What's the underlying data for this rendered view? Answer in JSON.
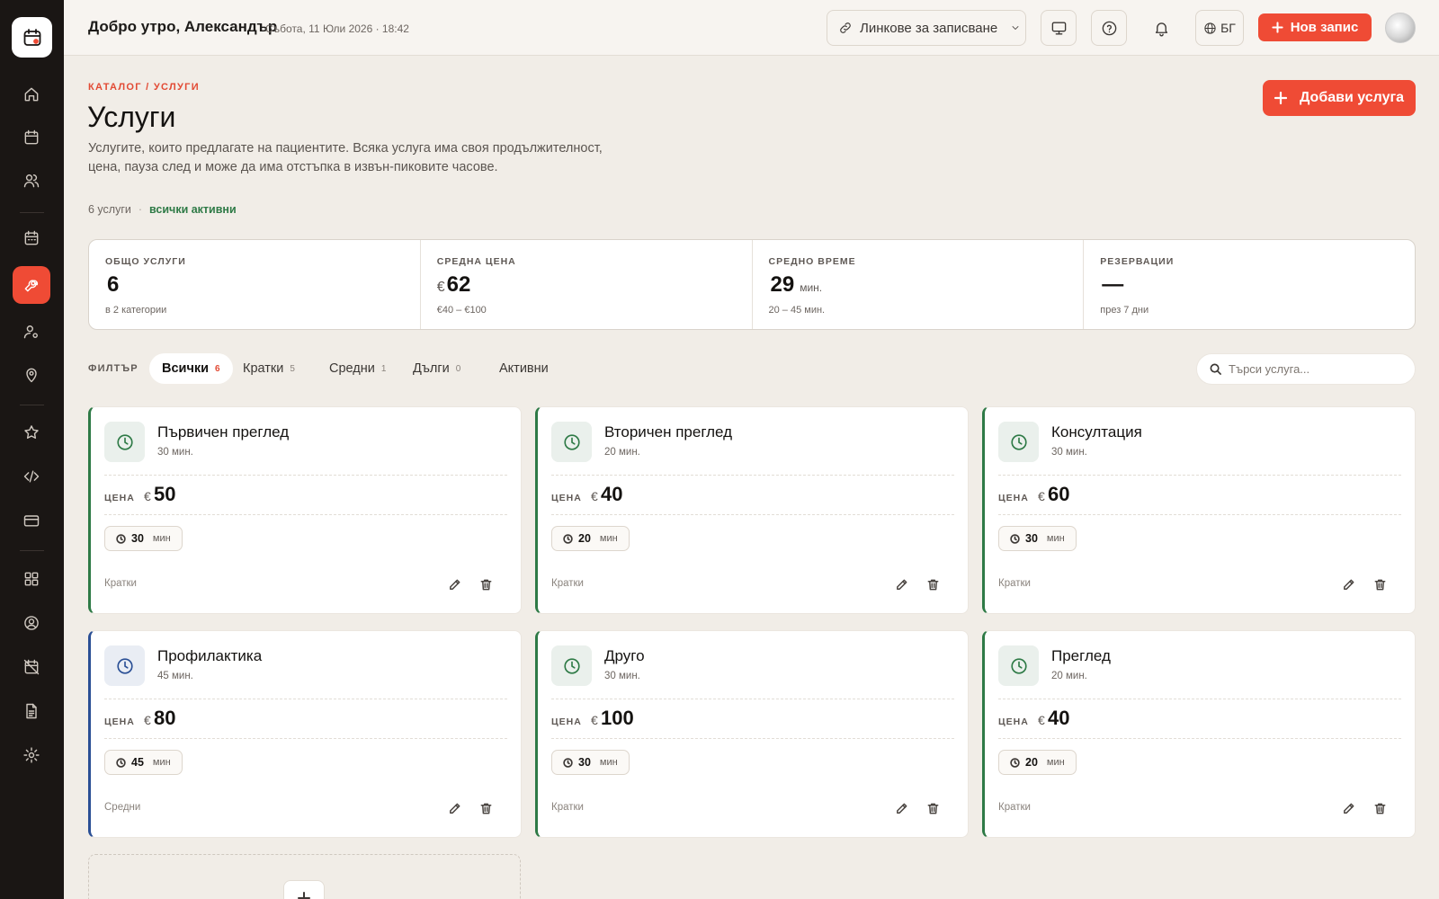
{
  "topbar": {
    "greeting": "Добро утро, Александър",
    "datetime": "Събота, 11 Юли 2026 · 18:42",
    "links_label": "Линкове за записване",
    "lang_label": "БГ",
    "new_record_label": "Нов запис"
  },
  "header": {
    "breadcrumb": "КАТАЛОГ / УСЛУГИ",
    "title": "Услуги",
    "description": "Услугите, които предлагате на пациентите. Всяка услуга има своя продължителност, цена, пауза след и може да има отстъпка в извън-пиковите часове.",
    "count_text": "6 услуги",
    "separator": "·",
    "status_text": "всички активни",
    "add_button_label": "Добави услуга"
  },
  "stats": [
    {
      "label": "ОБЩО УСЛУГИ",
      "currency": "",
      "value": "6",
      "unit": "",
      "sub": "в 2 категории"
    },
    {
      "label": "СРЕДНА ЦЕНА",
      "currency": "€",
      "value": "62",
      "unit": "",
      "sub": "€40 – €100"
    },
    {
      "label": "СРЕДНО ВРЕМЕ",
      "currency": "",
      "value": "29",
      "unit": "мин.",
      "sub": "20 – 45 мин."
    },
    {
      "label": "РЕЗЕРВАЦИИ",
      "currency": "",
      "value": "—",
      "unit": "",
      "sub": "през 7 дни"
    }
  ],
  "filter": {
    "label": "ФИЛТЪР",
    "chips": [
      {
        "label": "Всички",
        "count": "6"
      },
      {
        "label": "Кратки",
        "count": "5"
      },
      {
        "label": "Средни",
        "count": "1"
      },
      {
        "label": "Дълги",
        "count": "0"
      },
      {
        "label": "Активни",
        "count": ""
      }
    ],
    "search_placeholder": "Търси услуга..."
  },
  "card_labels": {
    "price_label": "ЦЕНА",
    "currency": "€",
    "pill_unit": "мин"
  },
  "services": [
    {
      "name": "Първичен преглед",
      "duration": "30 мин.",
      "price": "50",
      "pill": "30",
      "category": "Кратки",
      "accent": "#2e7a46"
    },
    {
      "name": "Вторичен преглед",
      "duration": "20 мин.",
      "price": "40",
      "pill": "20",
      "category": "Кратки",
      "accent": "#2e7a46"
    },
    {
      "name": "Консултация",
      "duration": "30 мин.",
      "price": "60",
      "pill": "30",
      "category": "Кратки",
      "accent": "#2e7a46"
    },
    {
      "name": "Профилактика",
      "duration": "45 мин.",
      "price": "80",
      "pill": "45",
      "category": "Средни",
      "accent": "#2a4f95"
    },
    {
      "name": "Друго",
      "duration": "30 мин.",
      "price": "100",
      "pill": "30",
      "category": "Кратки",
      "accent": "#2e7a46"
    },
    {
      "name": "Преглед",
      "duration": "20 мин.",
      "price": "40",
      "pill": "20",
      "category": "Кратки",
      "accent": "#2e7a46"
    }
  ],
  "colors": {
    "accent": "#ef4b35",
    "sidebar": "#1a1614",
    "background": "#f1ede7",
    "short_accent": "#2e7a46",
    "medium_accent": "#2a4f95"
  },
  "sidebar_icons": [
    "home-icon",
    "calendar-icon",
    "users-icon",
    "schedule-icon",
    "wrench-icon",
    "user-settings-icon",
    "location-icon",
    "star-icon",
    "code-icon",
    "credit-card-icon",
    "grid-icon",
    "user-circle-icon",
    "calendar-off-icon",
    "document-icon",
    "settings-icon"
  ]
}
